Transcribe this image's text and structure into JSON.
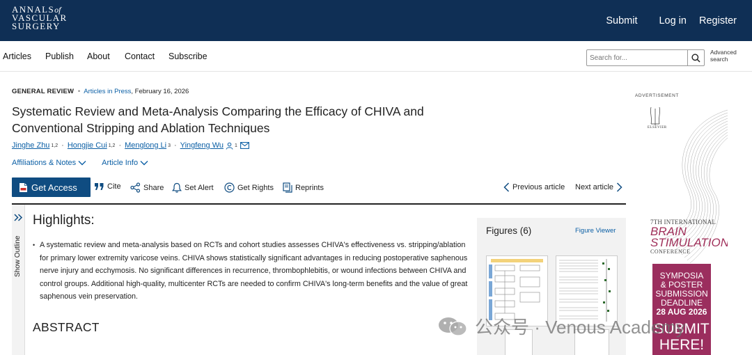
{
  "header": {
    "logo_line1": "ANNALS",
    "logo_of": "of",
    "logo_line2": "VASCULAR",
    "logo_line3": "SURGERY",
    "nav": [
      "Submit",
      "Log in",
      "Register"
    ]
  },
  "secondary_nav": {
    "items": [
      "Articles",
      "Publish",
      "About",
      "Contact",
      "Subscribe"
    ],
    "search_placeholder": "Search for...",
    "advanced_line1": "Advanced",
    "advanced_line2": "search"
  },
  "article": {
    "category": "GENERAL REVIEW",
    "status": "Articles in Press",
    "date": ", February 16, 2026",
    "title": "Systematic Review and Meta-Analysis Comparing the Efficacy of CHIVA and Conventional Stripping and Ablation Techniques",
    "authors": [
      {
        "name": "Jinghe Zhu",
        "aff": "1,2"
      },
      {
        "name": "Hongjie Cui",
        "aff": "1,2"
      },
      {
        "name": "Menglong Li",
        "aff": "3"
      },
      {
        "name": "Yingfeng Wu",
        "aff": "1"
      }
    ],
    "affiliations_label": "Affiliations & Notes",
    "article_info_label": "Article Info"
  },
  "toolbar": {
    "get_access": "Get Access",
    "cite": "Cite",
    "share": "Share",
    "set_alert": "Set Alert",
    "get_rights": "Get Rights",
    "reprints": "Reprints",
    "previous": "Previous article",
    "next": "Next article"
  },
  "outline_label": "Show Outline",
  "highlights": {
    "heading": "Highlights:",
    "text": "A systematic review and meta-analysis based on RCTs and cohort studies assesses CHIVA's effectiveness vs. stripping/ablation for primary lower extremity varicose veins. CHIVA shows statistically significant advantages in reducing postoperative saphenous nerve injury and ecchymosis. No significant differences in recurrence, thrombophlebitis, or wound infections between CHIVA and control groups. Additional high-quality, multicenter RCTs are needed to confirm CHIVA's long-term benefits and the value of great saphenous vein preservation."
  },
  "abstract_heading": "ABSTRACT",
  "figures": {
    "title": "Figures (6)",
    "viewer": "Figure Viewer"
  },
  "advertisement": {
    "label": "ADVERTISEMENT",
    "publisher": "ELSEVIER",
    "conf_line1": "7TH INTERNATIONAL",
    "conf_brain": "BRAIN",
    "conf_stim": "STIMULATION",
    "conf_conference": "CONFERENCE",
    "box_l1": "SYMPOSIA",
    "box_l2": "& POSTER",
    "box_l3": "SUBMISSION",
    "box_l4": "DEADLINE",
    "box_l5": "28 AUG 2026",
    "box_submit1": "SUBMIT",
    "box_submit2": "HERE!"
  },
  "watermark": "公众号 · Venous Academy",
  "colors": {
    "header_bg": "#0f2f55",
    "link": "#0b5fa5",
    "button_bg": "#0f4c81",
    "ad_accent": "#9b2e5e"
  }
}
